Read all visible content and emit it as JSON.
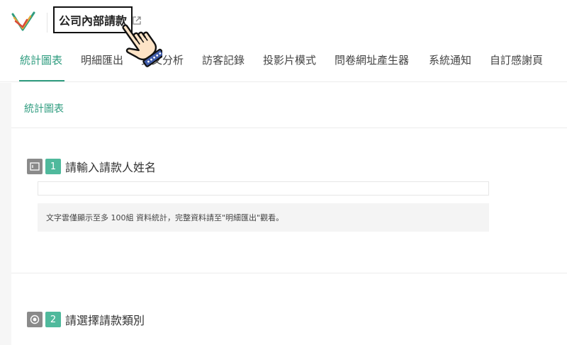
{
  "header": {
    "form_title": "公司內部請款"
  },
  "tabs": [
    {
      "label": "統計圖表",
      "active": true
    },
    {
      "label": "明細匯出",
      "active": false
    },
    {
      "label": "交叉分析",
      "active": false
    },
    {
      "label": "訪客記錄",
      "active": false
    },
    {
      "label": "投影片模式",
      "active": false
    },
    {
      "label": "問卷網址產生器",
      "active": false
    },
    {
      "label": "系統通知",
      "active": false
    },
    {
      "label": "自訂感謝頁",
      "active": false
    }
  ],
  "colors": {
    "accent": "#2f9c7f",
    "badge": "#4fb99c"
  },
  "section": {
    "title": "統計圖表"
  },
  "questions": [
    {
      "number": "1",
      "text": "請輸入請款人姓名",
      "icon": "text-field-icon"
    },
    {
      "number": "2",
      "text": "請選擇請款類別",
      "icon": "radio-icon"
    }
  ],
  "notice": "文字雲僅顯示至多 100組 資料統計，完整資料請至\"明細匯出\"觀看。"
}
